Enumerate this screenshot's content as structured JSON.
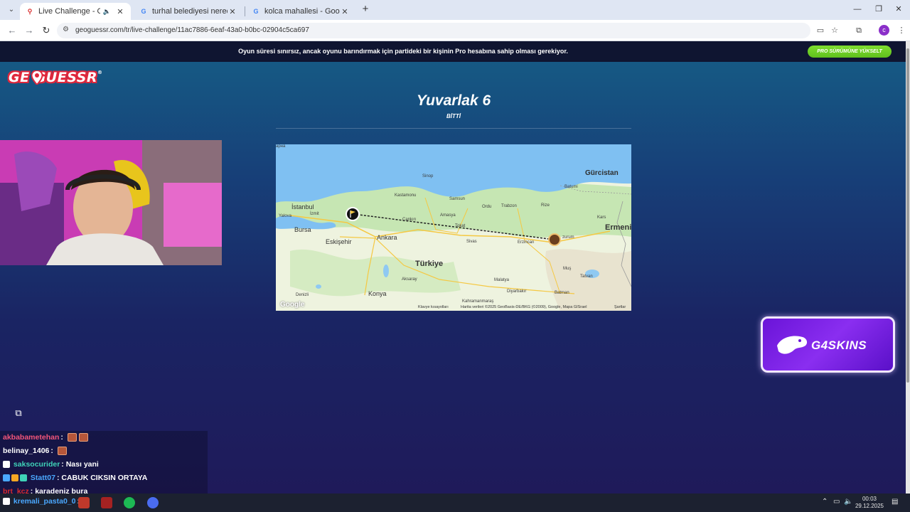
{
  "browser": {
    "tabs": [
      {
        "title": "Live Challenge - GeoGuessr",
        "active": true
      },
      {
        "title": "turhal belediyesi nerede - Goog",
        "active": false
      },
      {
        "title": "kolca mahallesi - Google'da Ara",
        "active": false
      }
    ],
    "url": "geoguessr.com/tr/live-challenge/11ac7886-6eaf-43a0-b0bc-02904c5ca697"
  },
  "banner": {
    "message": "Oyun süresi sınırsız, ancak oyunu barındırmak için partideki bir kişinin Pro hesabına sahip olması gerekiyor.",
    "button": "PRO SÜRÜMÜNE YÜKSELT"
  },
  "logo": {
    "text": "GE  GUESSR"
  },
  "round": {
    "title": "Yuvarlak 6",
    "status": "BİTTİ"
  },
  "map": {
    "labels": {
      "corner": "арна",
      "gurcistan": "Gürcistan",
      "sinop": "Sinop",
      "kastamonu": "Kastamonu",
      "samsun": "Samsun",
      "batumi": "Batumi",
      "istanbul": "İstanbul",
      "izmit": "İzmit",
      "yalova": "Yalova",
      "cankiri": "Çankırı",
      "amasya": "Amasya",
      "ordu": "Ordu",
      "trabzon": "Trabzon",
      "rize": "Rize",
      "kars": "Kars",
      "bursa": "Bursa",
      "tokat": "Tokat",
      "ermeni": "Ermeni",
      "ankara": "Ankara",
      "eskisehir": "Eskişehir",
      "sivas": "Sivas",
      "erzincan": "Erzincan",
      "erzurum": "zurum",
      "turkiye": "Türkiye",
      "mus": "Muş",
      "tatvan": "Tatvan",
      "aksaray": "Aksaray",
      "malatya": "Malatya",
      "denizli": "Denizli",
      "konya": "Konya",
      "diyarbakir": "Diyarbakır",
      "batman": "Batman",
      "kahramanmaras": "Kahramanmaraş"
    },
    "google": "Google",
    "footer_keys": "Klavye kısayolları",
    "footer_data": "Harita verileri ©2025 GeoBasis-DE/BKG (©2009), Google, Mapa GISrael",
    "footer_terms": "Şartlar"
  },
  "sponsor": {
    "text": "G4SKINS"
  },
  "chat": {
    "lines": [
      {
        "user": "akbabametehan",
        "text": "",
        "user_color": "#f2557a"
      },
      {
        "user": "belinay_1406",
        "text": "",
        "user_color": "#ffffff"
      },
      {
        "user": "saksocurider",
        "text": "Nası yani",
        "user_color": "#3fd3b8"
      },
      {
        "user": "Statt07",
        "text": "CABUK CIKSIN ORTAYA",
        "user_color": "#4aa8ff"
      },
      {
        "user": "brt_kcz",
        "text": "karadeniz bura",
        "user_color": "#d62b2b"
      },
      {
        "user": "kremali_pasta0_0",
        "text": "",
        "user_color": "#4aa8ff"
      }
    ]
  },
  "taskbar": {
    "time": "00:03",
    "date": "29.12.2025"
  },
  "colors": {
    "accent_green": "#6fd024",
    "route_line": "#222222",
    "map_sea": "#7fc0f2",
    "map_land": "#eef3df"
  }
}
